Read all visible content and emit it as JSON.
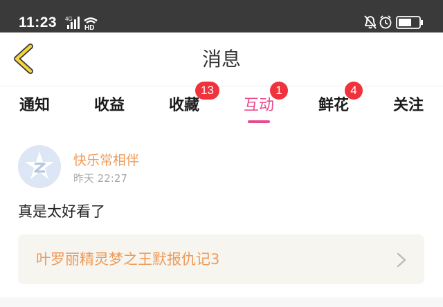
{
  "status_bar": {
    "time": "11:23",
    "network": "4G",
    "hd_label": "HD",
    "icons": [
      "signal-icon",
      "wifi-icon",
      "mute-bell-icon",
      "alarm-icon",
      "battery-icon"
    ]
  },
  "nav": {
    "title": "消息",
    "back_icon": "chevron-left-icon"
  },
  "tabs": [
    {
      "label": "通知",
      "badge": "",
      "active": false
    },
    {
      "label": "收益",
      "badge": "",
      "active": false
    },
    {
      "label": "收藏",
      "badge": "13",
      "active": false
    },
    {
      "label": "互动",
      "badge": "1",
      "active": true
    },
    {
      "label": "鲜花",
      "badge": "4",
      "active": false
    },
    {
      "label": "关注",
      "badge": "",
      "active": false
    }
  ],
  "message": {
    "username": "快乐常相伴",
    "timestamp": "昨天 22:27",
    "content": "真是太好看了",
    "source_title": "叶罗丽精灵梦之王默报仇记3"
  },
  "colors": {
    "accent": "#e94a8e",
    "badge": "#f0323c",
    "username": "#ee9a5a",
    "back_arrow": "#f2d63c"
  }
}
